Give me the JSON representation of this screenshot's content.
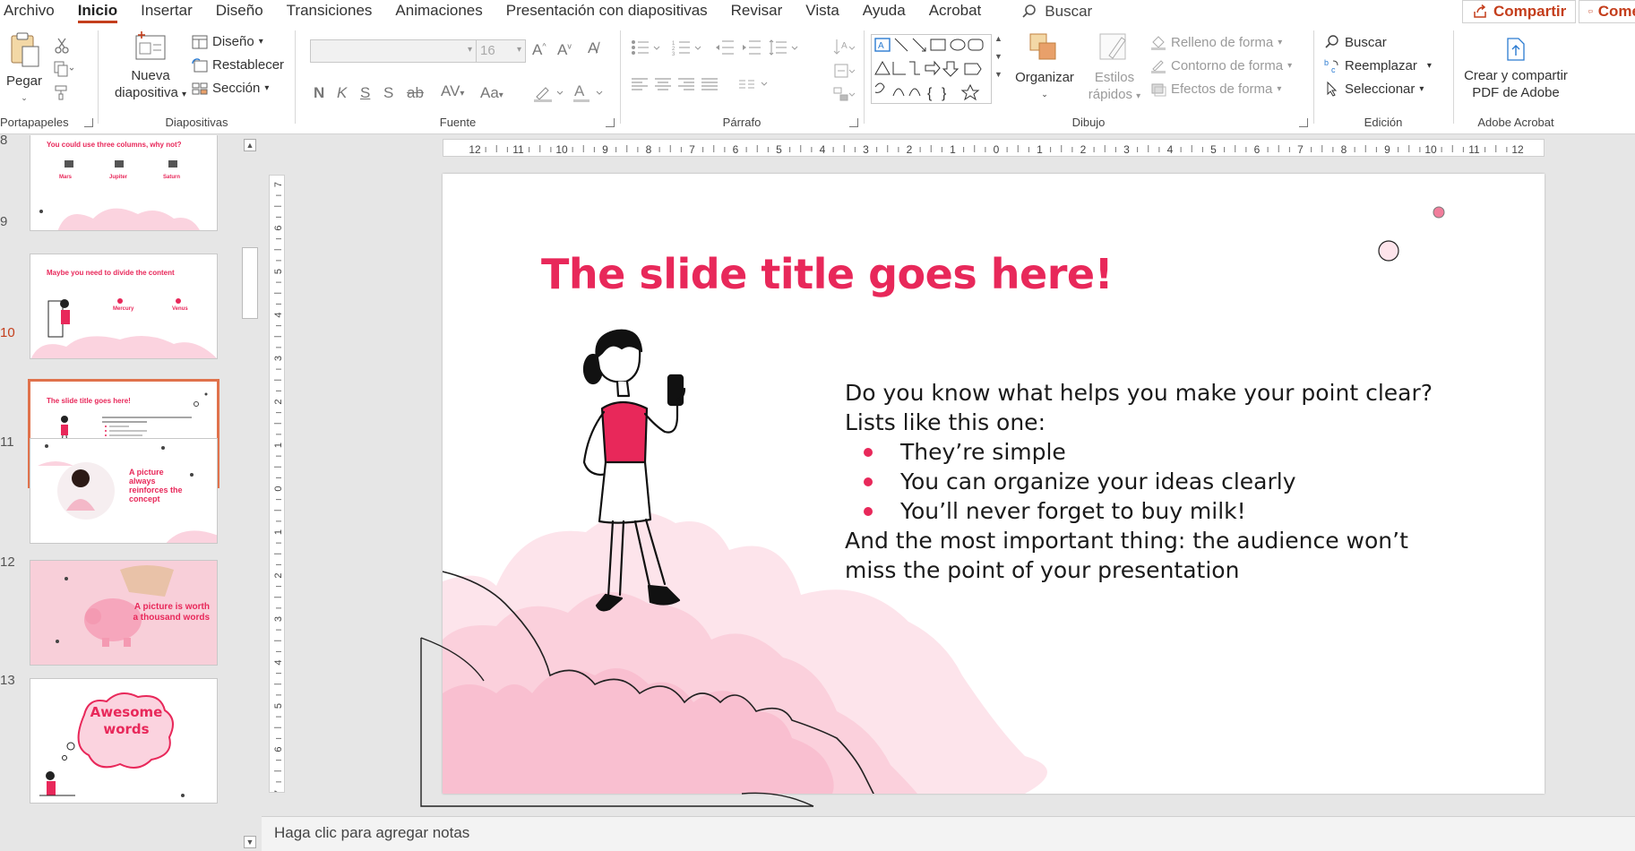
{
  "menu": {
    "tabs": [
      "Archivo",
      "Inicio",
      "Insertar",
      "Diseño",
      "Transiciones",
      "Animaciones",
      "Presentación con diapositivas",
      "Revisar",
      "Vista",
      "Ayuda",
      "Acrobat"
    ],
    "active_tab": "Inicio",
    "search_label": "Buscar",
    "share_label": "Compartir",
    "comments_label": "Come"
  },
  "ribbon": {
    "clipboard": {
      "paste": "Pegar",
      "label": "Portapapeles"
    },
    "slides": {
      "new_slide_line1": "Nueva",
      "new_slide_line2": "diapositiva",
      "layout": "Diseño",
      "reset": "Restablecer",
      "section": "Sección",
      "label": "Diapositivas"
    },
    "font": {
      "font_name": "",
      "font_size": "16",
      "bold": "N",
      "italic": "K",
      "underline": "S",
      "shadow": "S",
      "strike": "ab",
      "spacing": "AV",
      "case": "Aa",
      "label": "Fuente"
    },
    "paragraph": {
      "label": "Párrafo"
    },
    "drawing": {
      "arrange": "Organizar",
      "quick_styles_line1": "Estilos",
      "quick_styles_line2": "rápidos",
      "shape_fill": "Relleno de forma",
      "shape_outline": "Contorno de forma",
      "shape_effects": "Efectos de forma",
      "label": "Dibujo"
    },
    "editing": {
      "find": "Buscar",
      "replace": "Reemplazar",
      "select": "Seleccionar",
      "label": "Edición"
    },
    "acrobat": {
      "create_line1": "Crear y compartir",
      "create_line2": "PDF de Adobe",
      "label": "Adobe Acrobat"
    }
  },
  "thumbnails": [
    {
      "number": "8",
      "title": "You could use three columns, why not?",
      "items": [
        "Mars",
        "Jupiter",
        "Saturn"
      ]
    },
    {
      "number": "9",
      "title": "Maybe you need to divide the content",
      "items": [
        "Mercury",
        "Venus"
      ]
    },
    {
      "number": "10",
      "title": "The slide title goes here!",
      "selected": true
    },
    {
      "number": "11",
      "title": "A picture always reinforces the concept"
    },
    {
      "number": "12",
      "title": "A picture is worth a thousand words"
    },
    {
      "number": "13",
      "title": "Awesome words"
    }
  ],
  "rulers": {
    "horizontal": [
      "12",
      "11",
      "10",
      "9",
      "8",
      "7",
      "6",
      "5",
      "4",
      "3",
      "2",
      "1",
      "0",
      "1",
      "2",
      "3",
      "4",
      "5",
      "6",
      "7",
      "8",
      "9",
      "10",
      "11",
      "12"
    ],
    "vertical": [
      "7",
      "6",
      "5",
      "4",
      "3",
      "2",
      "1",
      "0",
      "1",
      "2",
      "3",
      "4",
      "5",
      "6",
      "7"
    ]
  },
  "slide": {
    "title": "The slide title goes here!",
    "intro_line1": "Do you know what helps you make your point clear?",
    "intro_line2": "Lists like this one:",
    "bullets": [
      "They’re simple",
      "You can organize your ideas clearly",
      "You’ll never forget to buy milk!"
    ],
    "closing_line1": "And the most important thing: the audience won’t",
    "closing_line2": "miss the point of your presentation",
    "accent_color": "#e8285a",
    "cloud_color": "#fbd3df"
  },
  "notes": {
    "placeholder": "Haga clic para agregar notas"
  }
}
